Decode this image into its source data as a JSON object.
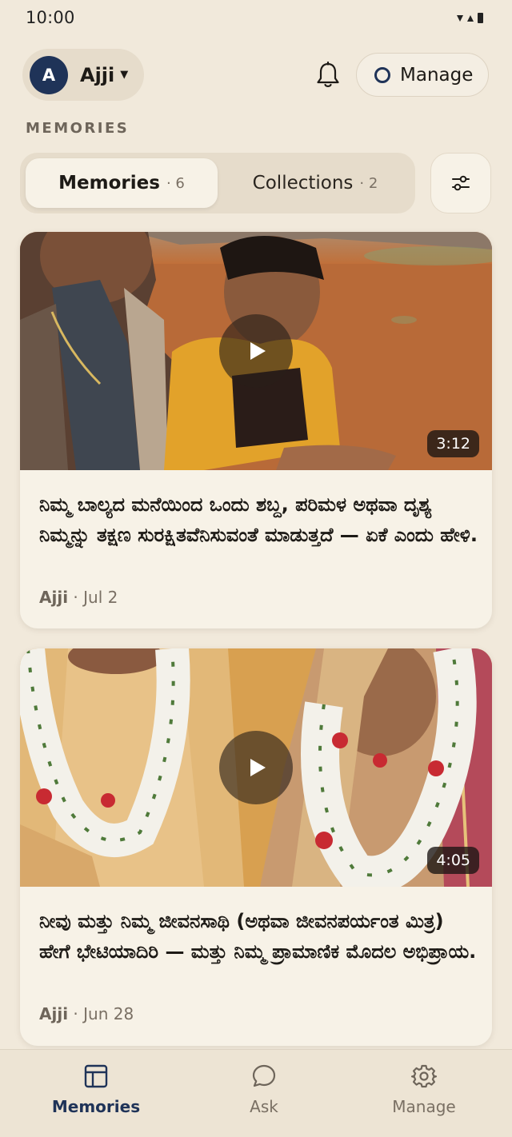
{
  "status_bar": {
    "time": "10:00"
  },
  "header": {
    "avatar_initial": "A",
    "profile_name": "Ajji",
    "manage_label": "Manage"
  },
  "section_label": "MEMORIES",
  "tabs": [
    {
      "label": "Memories",
      "count": "· 6",
      "active": true
    },
    {
      "label": "Collections",
      "count": "· 2",
      "active": false
    }
  ],
  "cards": [
    {
      "duration": "3:12",
      "title": "ನಿಮ್ಮ ಬಾಲ್ಯದ ಮನೆಯಿಂದ ಒಂದು ಶಬ್ದ, ಪರಿಮಳ ಅಥವಾ ದೃಶ್ಯ ನಿಮ್ಮನ್ನು ತಕ್ಷಣ ಸುರಕ್ಷಿತವೆನಿಸುವಂತೆ ಮಾಡುತ್ತದೆ — ಏಕೆ ಎಂದು ಹೇಳಿ.",
      "author": "Ajji",
      "date": "· Jul 2"
    },
    {
      "duration": "4:05",
      "title": "ನೀವು ಮತ್ತು ನಿಮ್ಮ ಜೀವನಸಾಥಿ (ಅಥವಾ ಜೀವನಪರ್ಯಂತ ಮಿತ್ರ) ಹೇಗೆ ಭೇಟಿಯಾದಿರಿ — ಮತ್ತು ನಿಮ್ಮ ಪ್ರಾಮಾಣಿಕ ಮೊದಲ ಅಭಿಪ್ರಾಯ.",
      "author": "Ajji",
      "date": "· Jun 28"
    }
  ],
  "bottom_nav": [
    {
      "label": "Memories",
      "icon": "layout-icon",
      "active": true
    },
    {
      "label": "Ask",
      "icon": "chat-bubble-icon",
      "active": false
    },
    {
      "label": "Manage",
      "icon": "gear-icon",
      "active": false
    }
  ],
  "colors": {
    "background": "#f1e9db",
    "accent": "#1f3358",
    "card": "#f7f2e7"
  }
}
